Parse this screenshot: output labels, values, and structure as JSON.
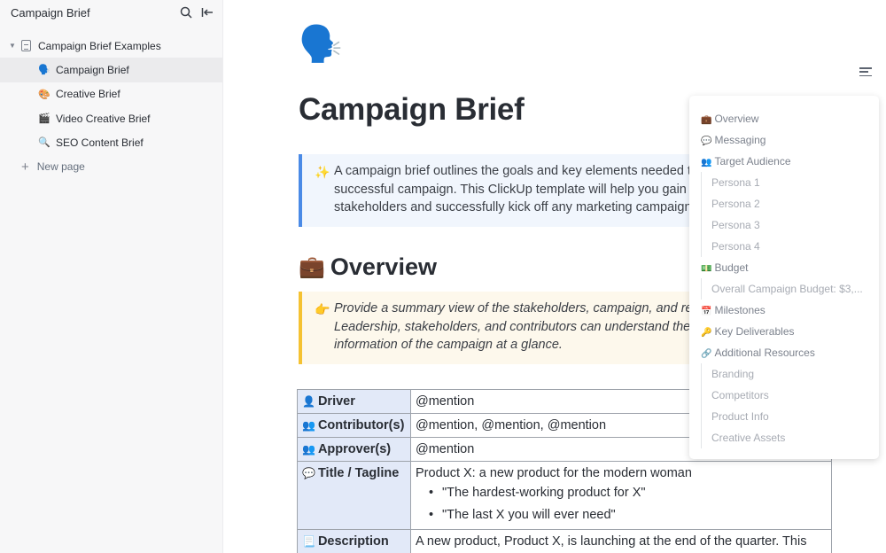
{
  "sidebar": {
    "title": "Campaign Brief",
    "icons": [
      "search-icon",
      "collapse-sidebar-icon"
    ],
    "root": {
      "label": "Campaign Brief Examples"
    },
    "items": [
      {
        "emoji": "🗣️",
        "label": "Campaign Brief",
        "active": true
      },
      {
        "emoji": "🎨",
        "label": "Creative Brief"
      },
      {
        "emoji": "🎬",
        "label": "Video Creative Brief"
      },
      {
        "emoji": "🔍",
        "label": "SEO Content Brief"
      }
    ],
    "new_page": "New page"
  },
  "page": {
    "icon": "🗣️",
    "title": "Campaign Brief",
    "intro_callout": {
      "emoji": "✨",
      "text": "A campaign brief outlines the goals and key elements needed to c successful campaign. This ClickUp template will help you gain ali stakeholders and successfully kick off any marketing campaign."
    },
    "overview": {
      "emoji": "💼",
      "heading": "Overview",
      "callout": {
        "emoji": "👉",
        "text": "Provide a summary view of the stakeholders, campaign, and reso Leadership, stakeholders, and contributors can understand the p information of the campaign at a glance."
      }
    },
    "table": {
      "rows": [
        {
          "emoji": "👤",
          "key": "Driver",
          "value": "@mention"
        },
        {
          "emoji": "👥",
          "key": "Contributor(s)",
          "value": "@mention, @mention, @mention"
        },
        {
          "emoji": "👥",
          "key": "Approver(s)",
          "value": "@mention"
        },
        {
          "emoji": "💬",
          "key": "Title / Tagline",
          "value": "Product X: a new product for the modern woman",
          "bullets": [
            "\"The hardest-working product for X\"",
            "\"The last X you will ever need\""
          ]
        },
        {
          "emoji": "📃",
          "key": "Description",
          "value": "A new product, Product X, is launching at the end of the quarter. This product will revolutionize the industry and we will need a large campaign"
        }
      ]
    }
  },
  "toc": {
    "items": [
      {
        "emoji": "💼",
        "label": "Overview",
        "level": 1
      },
      {
        "emoji": "💬",
        "label": "Messaging",
        "level": 1
      },
      {
        "emoji": "👥",
        "label": "Target Audience",
        "level": 1
      },
      {
        "label": "Persona 1",
        "level": 2
      },
      {
        "label": "Persona 2",
        "level": 2
      },
      {
        "label": "Persona 3",
        "level": 2
      },
      {
        "label": "Persona 4",
        "level": 2
      },
      {
        "emoji": "💵",
        "label": "Budget",
        "level": 1
      },
      {
        "label": "Overall Campaign Budget: $3,...",
        "level": 2
      },
      {
        "emoji": "📅",
        "label": "Milestones",
        "level": 1
      },
      {
        "emoji": "🔑",
        "label": "Key Deliverables",
        "level": 1
      },
      {
        "emoji": "🔗",
        "label": "Additional Resources",
        "level": 1
      },
      {
        "label": "Branding",
        "level": 2
      },
      {
        "label": "Competitors",
        "level": 2
      },
      {
        "label": "Product Info",
        "level": 2
      },
      {
        "label": "Creative Assets",
        "level": 2
      }
    ]
  }
}
